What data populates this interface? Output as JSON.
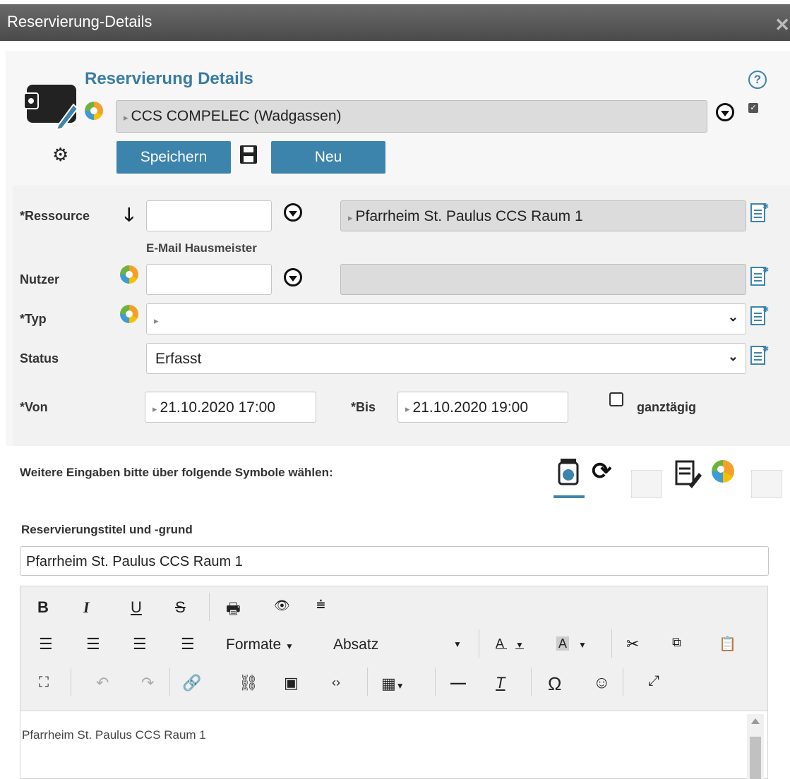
{
  "window": {
    "title": "Reservierung-Details",
    "close_icon": "close-icon"
  },
  "header": {
    "heading": "Reservierung Details",
    "help_icon": "help-icon",
    "organization": "CCS COMPELEC (Wadgassen)",
    "save_label": "Speichern",
    "new_label": "Neu"
  },
  "form": {
    "ressource": {
      "label": "*Ressource",
      "value": "",
      "display": "Pfarrheim St. Paulus CCS Raum 1",
      "sublabel": "E-Mail Hausmeister"
    },
    "nutzer": {
      "label": "Nutzer",
      "value": "",
      "display": ""
    },
    "typ": {
      "label": "*Typ",
      "value": ""
    },
    "status": {
      "label": "Status",
      "value": "Erfasst",
      "options": [
        "Erfasst"
      ]
    },
    "von": {
      "label": "*Von",
      "value": "21.10.2020 17:00"
    },
    "bis": {
      "label": "*Bis",
      "value": "21.10.2020 19:00"
    },
    "ganztaegig": {
      "label": "ganztägig",
      "checked": false
    }
  },
  "more": {
    "text": "Weitere Eingaben bitte über folgende Symbole wählen:"
  },
  "reason": {
    "label": "Reservierungstitel und -grund",
    "title_value": "Pfarrheim St. Paulus CCS Raum 1",
    "editor_text": "Pfarrheim St. Paulus CCS Raum 1"
  },
  "editor_toolbar": {
    "formats_label": "Formate",
    "paragraph_label": "Absatz"
  },
  "colors": {
    "accent": "#3d84ad",
    "heading": "#3a7ca5",
    "titlebar": "#555555"
  }
}
